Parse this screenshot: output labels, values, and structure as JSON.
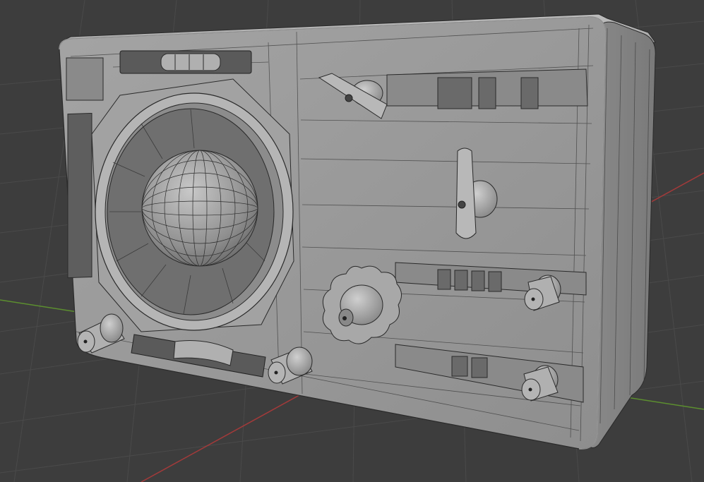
{
  "viewport": {
    "kind": "3d-viewport",
    "background_color": "#3d3d3d",
    "grid_color": "#4a4a4a",
    "x_axis_color": "#a33a3a",
    "y_axis_color": "#5c8f2f"
  },
  "model": {
    "object": "radio-device",
    "shading": "solid-wireframe",
    "surface_color": "#9a9a9a",
    "wire_color": "#2a2a2a",
    "front_panel": {
      "tuning_dial": "porthole-window-with-sphere",
      "toggle_switches": 2,
      "fluted_knob": 1,
      "small_knobs": 4,
      "indicator_windows": 3,
      "slider_slots": 2
    }
  }
}
